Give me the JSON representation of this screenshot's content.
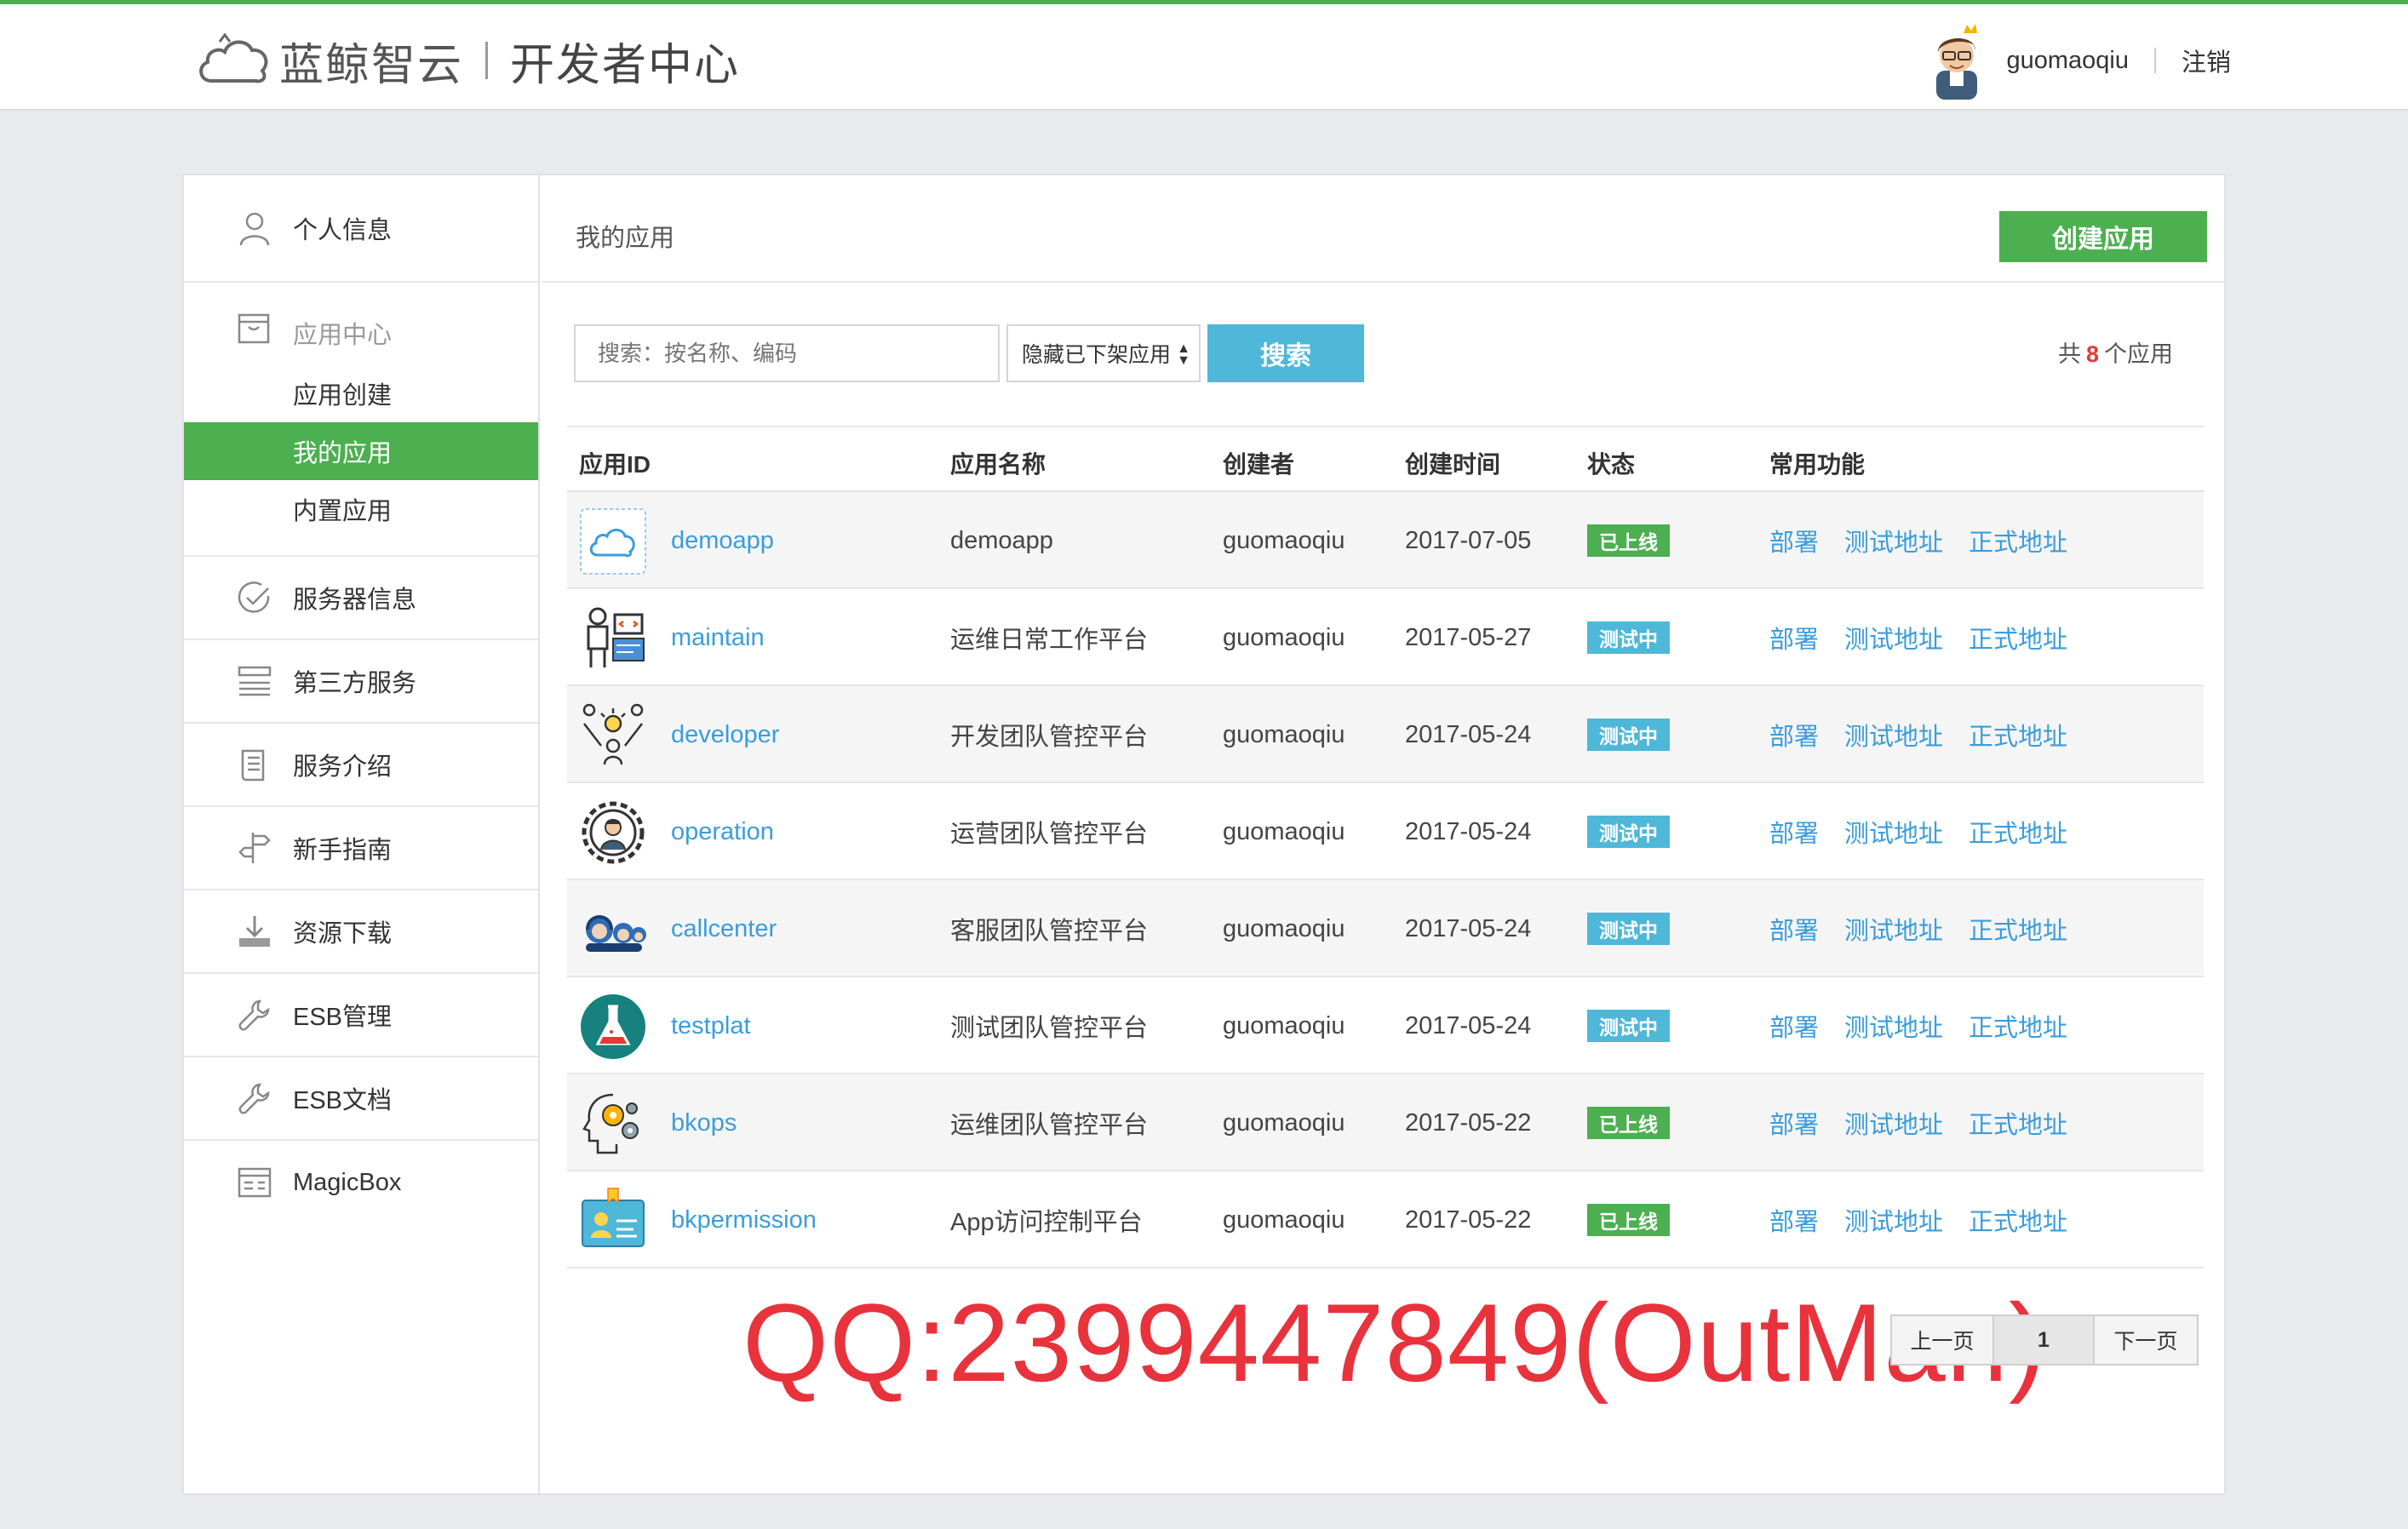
{
  "header": {
    "brand": "蓝鲸智云",
    "subtitle": "开发者中心",
    "username": "guomaoqiu",
    "logout": "注销"
  },
  "sidebar": {
    "profile": "个人信息",
    "app_center": {
      "label": "应用中心",
      "items": [
        "应用创建",
        "我的应用",
        "内置应用"
      ]
    },
    "items": [
      "服务器信息",
      "第三方服务",
      "服务介绍",
      "新手指南",
      "资源下载",
      "ESB管理",
      "ESB文档",
      "MagicBox"
    ]
  },
  "main": {
    "title": "我的应用",
    "create_button": "创建应用",
    "search_placeholder": "搜索：按名称、编码",
    "filter_value": "隐藏已下架应用",
    "search_button": "搜索",
    "total_prefix": "共",
    "total_count": "8",
    "total_suffix": "个应用"
  },
  "table": {
    "headers": [
      "应用ID",
      "应用名称",
      "创建者",
      "创建时间",
      "状态",
      "常用功能"
    ],
    "actions": [
      "部署",
      "测试地址",
      "正式地址"
    ],
    "rows": [
      {
        "id": "demoapp",
        "name": "demoapp",
        "creator": "guomaoqiu",
        "created": "2017-07-05",
        "status": "已上线",
        "icon": "cloud-icon"
      },
      {
        "id": "maintain",
        "name": "运维日常工作平台",
        "creator": "guomaoqiu",
        "created": "2017-05-27",
        "status": "测试中",
        "icon": "operator-icon"
      },
      {
        "id": "developer",
        "name": "开发团队管控平台",
        "creator": "guomaoqiu",
        "created": "2017-05-24",
        "status": "测试中",
        "icon": "team-idea-icon"
      },
      {
        "id": "operation",
        "name": "运营团队管控平台",
        "creator": "guomaoqiu",
        "created": "2017-05-24",
        "status": "测试中",
        "icon": "gear-person-icon"
      },
      {
        "id": "callcenter",
        "name": "客服团队管控平台",
        "creator": "guomaoqiu",
        "created": "2017-05-24",
        "status": "测试中",
        "icon": "headset-people-icon"
      },
      {
        "id": "testplat",
        "name": "测试团队管控平台",
        "creator": "guomaoqiu",
        "created": "2017-05-24",
        "status": "测试中",
        "icon": "flask-icon"
      },
      {
        "id": "bkops",
        "name": "运维团队管控平台",
        "creator": "guomaoqiu",
        "created": "2017-05-22",
        "status": "已上线",
        "icon": "head-gears-icon"
      },
      {
        "id": "bkpermission",
        "name": "App访问控制平台",
        "creator": "guomaoqiu",
        "created": "2017-05-22",
        "status": "已上线",
        "icon": "id-card-icon"
      }
    ]
  },
  "pagination": {
    "prev": "上一页",
    "current": "1",
    "next": "下一页"
  },
  "watermark": "QQ:2399447849(OutMan)",
  "colors": {
    "accent_green": "#4caf50",
    "accent_blue": "#4fb7d8",
    "link_blue": "#3a9ddb",
    "watermark_red": "#e8323c"
  }
}
